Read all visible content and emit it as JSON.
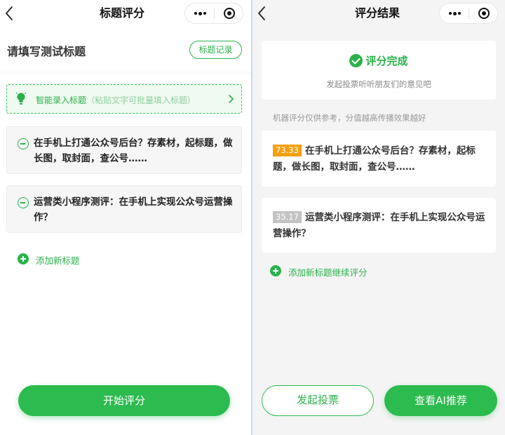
{
  "colors": {
    "accent": "#2bbb4e",
    "score_high": "#f4a011",
    "score_low": "#c3c3c3",
    "divider": "#c9d6ef"
  },
  "left": {
    "nav": {
      "title": "标题评分",
      "back_icon": "chevron-left-icon",
      "more_icon": "more-dots-icon",
      "close_icon": "target-circle-icon"
    },
    "header": {
      "title": "请填写测试标题",
      "record_button": "标题记录"
    },
    "smart_entry": {
      "label": "智能录入标题",
      "hint": "（粘贴文字可批量填入标题）",
      "icon": "lightbulb-icon"
    },
    "titles": [
      {
        "text": "在手机上打通公众号后台？存素材，起标题，做长图，取封面，查公号……"
      },
      {
        "text": "运营类小程序测评：在手机上实现公众号运营操作？"
      }
    ],
    "add_title": "添加新标题",
    "start_button": "开始评分"
  },
  "right": {
    "nav": {
      "title": "评分结果",
      "back_icon": "chevron-left-icon",
      "more_icon": "more-dots-icon",
      "close_icon": "target-circle-icon"
    },
    "status": {
      "title": "评分完成",
      "subtitle": "发起投票听听朋友们的意见吧"
    },
    "note": "机器评分仅供参考，分值越高传播效果越好",
    "results": [
      {
        "score": "73.33",
        "text": "在手机上打通公众号后台？存素材，起标题，做长图，取封面，查公号……"
      },
      {
        "score": "35.17",
        "text": "运营类小程序测评：在手机上实现公众号运营操作？"
      }
    ],
    "add_more": "添加新标题继续评分",
    "vote_button": "发起投票",
    "ai_button": "查看AI推荐"
  }
}
